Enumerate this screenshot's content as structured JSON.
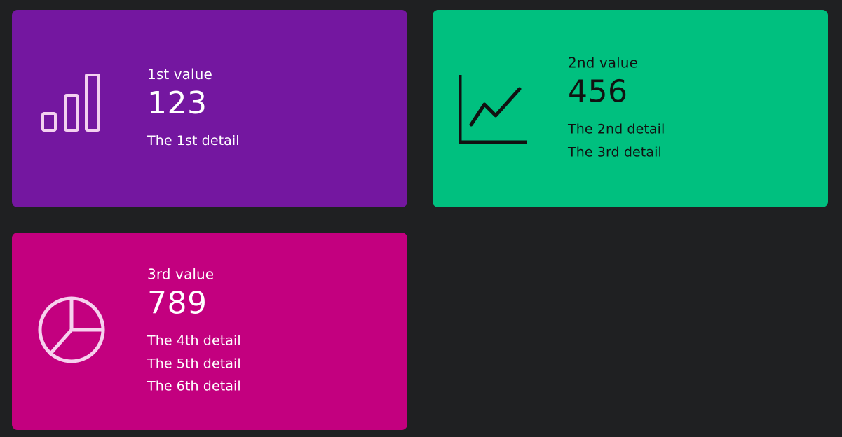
{
  "cards": [
    {
      "label": "1st value",
      "value": "123",
      "details": [
        "The 1st detail"
      ],
      "icon": "bar-chart-icon",
      "background": "#7417a0",
      "text_color": "#ffffff",
      "icon_color": "#f3d1f0"
    },
    {
      "label": "2nd value",
      "value": "456",
      "details": [
        "The 2nd detail",
        "The 3rd detail"
      ],
      "icon": "line-chart-icon",
      "background": "#00c07f",
      "text_color": "#111111",
      "icon_color": "#111111"
    },
    {
      "label": "3rd value",
      "value": "789",
      "details": [
        "The 4th detail",
        "The 5th detail",
        "The 6th detail"
      ],
      "icon": "pie-chart-icon",
      "background": "#c3007f",
      "text_color": "#ffffff",
      "icon_color": "#f6d1ee"
    }
  ]
}
